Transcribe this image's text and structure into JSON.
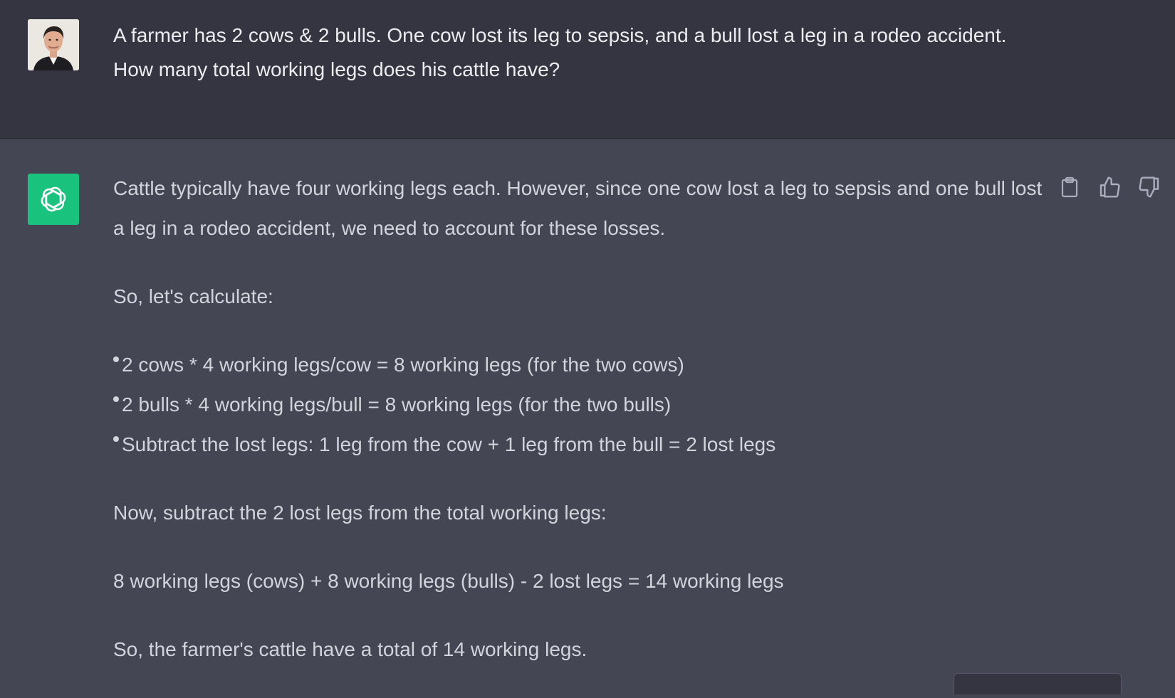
{
  "user_message": {
    "text": "A farmer has 2 cows & 2 bulls. One cow lost its leg to sepsis, and a bull lost a leg in a rodeo accident. How many total working legs does his cattle have?"
  },
  "assistant_message": {
    "paragraph_1": "Cattle typically have four working legs each. However, since one cow lost a leg to sepsis and one bull lost a leg in a rodeo accident, we need to account for these losses.",
    "paragraph_2": "So, let's calculate:",
    "bullets": [
      "2 cows * 4 working legs/cow = 8 working legs (for the two cows)",
      "2 bulls * 4 working legs/bull = 8 working legs (for the two bulls)",
      "Subtract the lost legs: 1 leg from the cow + 1 leg from the bull = 2 lost legs"
    ],
    "paragraph_3": "Now, subtract the 2 lost legs from the total working legs:",
    "paragraph_4": "8 working legs (cows) + 8 working legs (bulls) - 2 lost legs = 14 working legs",
    "paragraph_5": "So, the farmer's cattle have a total of 14 working legs."
  },
  "actions": {
    "icons": [
      "clipboard-icon",
      "thumbs-up-icon",
      "thumbs-down-icon"
    ]
  },
  "colors": {
    "user_bg": "#343541",
    "assistant_bg": "#444654",
    "gpt_avatar_bg": "#19c37d",
    "text": "#d1d5db"
  }
}
